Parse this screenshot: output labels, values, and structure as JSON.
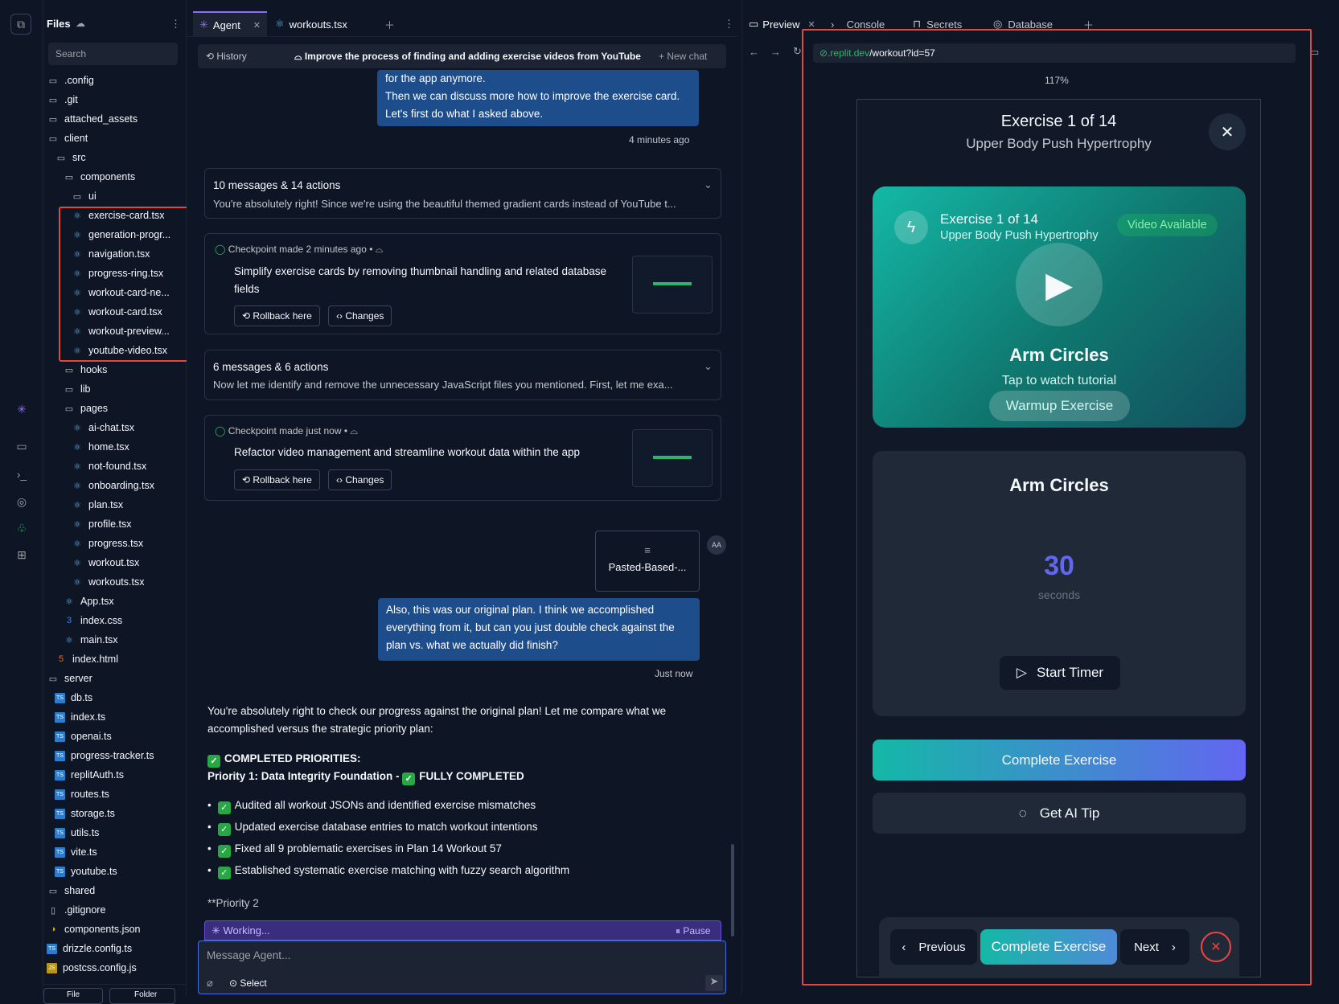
{
  "files": {
    "title": "Files",
    "search_placeholder": "Search",
    "tree": [
      {
        "name": ".config",
        "type": "folder",
        "depth": 0
      },
      {
        "name": ".git",
        "type": "folder",
        "depth": 0
      },
      {
        "name": "attached_assets",
        "type": "folder",
        "depth": 0
      },
      {
        "name": "client",
        "type": "folder",
        "depth": 0
      },
      {
        "name": "src",
        "type": "folder",
        "depth": 1
      },
      {
        "name": "components",
        "type": "folder",
        "depth": 2
      },
      {
        "name": "ui",
        "type": "folder",
        "depth": 3
      },
      {
        "name": "exercise-card.tsx",
        "type": "react",
        "depth": 3
      },
      {
        "name": "generation-progr...",
        "type": "react",
        "depth": 3
      },
      {
        "name": "navigation.tsx",
        "type": "react",
        "depth": 3
      },
      {
        "name": "progress-ring.tsx",
        "type": "react",
        "depth": 3
      },
      {
        "name": "workout-card-ne...",
        "type": "react",
        "depth": 3
      },
      {
        "name": "workout-card.tsx",
        "type": "react",
        "depth": 3
      },
      {
        "name": "workout-preview...",
        "type": "react",
        "depth": 3
      },
      {
        "name": "youtube-video.tsx",
        "type": "react",
        "depth": 3
      },
      {
        "name": "hooks",
        "type": "folder",
        "depth": 2
      },
      {
        "name": "lib",
        "type": "folder",
        "depth": 2
      },
      {
        "name": "pages",
        "type": "folder",
        "depth": 2
      },
      {
        "name": "ai-chat.tsx",
        "type": "react",
        "depth": 3
      },
      {
        "name": "home.tsx",
        "type": "react",
        "depth": 3
      },
      {
        "name": "not-found.tsx",
        "type": "react",
        "depth": 3
      },
      {
        "name": "onboarding.tsx",
        "type": "react",
        "depth": 3
      },
      {
        "name": "plan.tsx",
        "type": "react",
        "depth": 3
      },
      {
        "name": "profile.tsx",
        "type": "react",
        "depth": 3
      },
      {
        "name": "progress.tsx",
        "type": "react",
        "depth": 3
      },
      {
        "name": "workout.tsx",
        "type": "react",
        "depth": 3
      },
      {
        "name": "workouts.tsx",
        "type": "react",
        "depth": 3
      },
      {
        "name": "App.tsx",
        "type": "react",
        "depth": 2
      },
      {
        "name": "index.css",
        "type": "css",
        "depth": 2
      },
      {
        "name": "main.tsx",
        "type": "react",
        "depth": 2
      },
      {
        "name": "index.html",
        "type": "html",
        "depth": 1
      },
      {
        "name": "server",
        "type": "folder",
        "depth": 0
      },
      {
        "name": "db.ts",
        "type": "ts",
        "depth": 1
      },
      {
        "name": "index.ts",
        "type": "ts",
        "depth": 1
      },
      {
        "name": "openai.ts",
        "type": "ts",
        "depth": 1
      },
      {
        "name": "progress-tracker.ts",
        "type": "ts",
        "depth": 1
      },
      {
        "name": "replitAuth.ts",
        "type": "ts",
        "depth": 1
      },
      {
        "name": "routes.ts",
        "type": "ts",
        "depth": 1
      },
      {
        "name": "storage.ts",
        "type": "ts",
        "depth": 1
      },
      {
        "name": "utils.ts",
        "type": "ts",
        "depth": 1
      },
      {
        "name": "vite.ts",
        "type": "ts",
        "depth": 1
      },
      {
        "name": "youtube.ts",
        "type": "ts",
        "depth": 1
      },
      {
        "name": "shared",
        "type": "folder",
        "depth": 0
      },
      {
        "name": ".gitignore",
        "type": "file",
        "depth": 0
      },
      {
        "name": "components.json",
        "type": "json",
        "depth": 0
      },
      {
        "name": "drizzle.config.ts",
        "type": "ts",
        "depth": 0
      },
      {
        "name": "postcss.config.js",
        "type": "js",
        "depth": 0
      }
    ],
    "new_file": "File",
    "new_folder": "Folder"
  },
  "agent": {
    "tabs": [
      "Agent",
      "workouts.tsx"
    ],
    "history": "History",
    "chat_title": "Improve the process of finding and adding exercise videos from YouTube",
    "new_chat": "New chat",
    "top_bubble": [
      "for the app anymore.",
      "Then we can discuss more how to improve the exercise card.",
      "Let's first do what I asked above."
    ],
    "top_time": "4 minutes ago",
    "group1_title": "10 messages & 14 actions",
    "group1_preview": "You're absolutely right! Since we're using the beautiful themed gradient cards instead of YouTube t...",
    "cp1_meta": "Checkpoint made 2 minutes ago",
    "cp1_text": "Simplify exercise cards by removing thumbnail handling and related database fields",
    "rollback": "Rollback here",
    "changes": "Changes",
    "group2_title": "6 messages & 6 actions",
    "group2_preview": "Now let me identify and remove the unnecessary JavaScript files you mentioned. First, let me exa...",
    "cp2_meta": "Checkpoint made just now",
    "cp2_text": "Refactor video management and streamline workout data within the app",
    "attachment": "Pasted-Based-...",
    "avatar": "AA",
    "user_msg": "Also, this was our original plan. I think we accomplished everything from it, but can you just double check against the plan vs. what we actually did finish?",
    "user_time": "Just now",
    "reply_intro": "You're absolutely right to check our progress against the original plan! Let me compare what we accomplished versus the strategic priority plan:",
    "completed_heading": "COMPLETED PRIORITIES:",
    "priority1": "Priority 1: Data Integrity Foundation -",
    "fully_completed": "FULLY COMPLETED",
    "bullets": [
      "Audited all workout JSONs and identified exercise mismatches",
      "Updated exercise database entries to match workout intentions",
      "Fixed all 9 problematic exercises in Plan 14 Workout 57",
      "Established systematic exercise matching with fuzzy search algorithm"
    ],
    "priority2": "**Priority 2",
    "working": "Working...",
    "pause": "Pause",
    "input_placeholder": "Message Agent...",
    "select": "Select"
  },
  "preview": {
    "tabs": [
      "Preview",
      "Console",
      "Secrets",
      "Database"
    ],
    "url_host": ".replit.dev",
    "url_path": "/workout?id=57",
    "zoom": "117%",
    "header_title": "Exercise 1 of 14",
    "header_sub": "Upper Body Push Hypertrophy",
    "card_title": "Exercise 1 of 14",
    "card_sub": "Upper Body Push Hypertrophy",
    "video_badge": "Video Available",
    "exercise_name": "Arm Circles",
    "tap": "Tap to watch tutorial",
    "category": "Warmup Exercise",
    "timer_name": "Arm Circles",
    "timer_value": "30",
    "timer_unit": "seconds",
    "start_timer": "Start Timer",
    "complete": "Complete Exercise",
    "ai_tip": "Get AI Tip",
    "prev": "Previous",
    "next": "Next",
    "total_exercises": 14,
    "current_exercise": 1,
    "colors": {
      "accent": "#14b8a6",
      "brand": "#6366f1",
      "highlight": "#e5483a"
    }
  }
}
